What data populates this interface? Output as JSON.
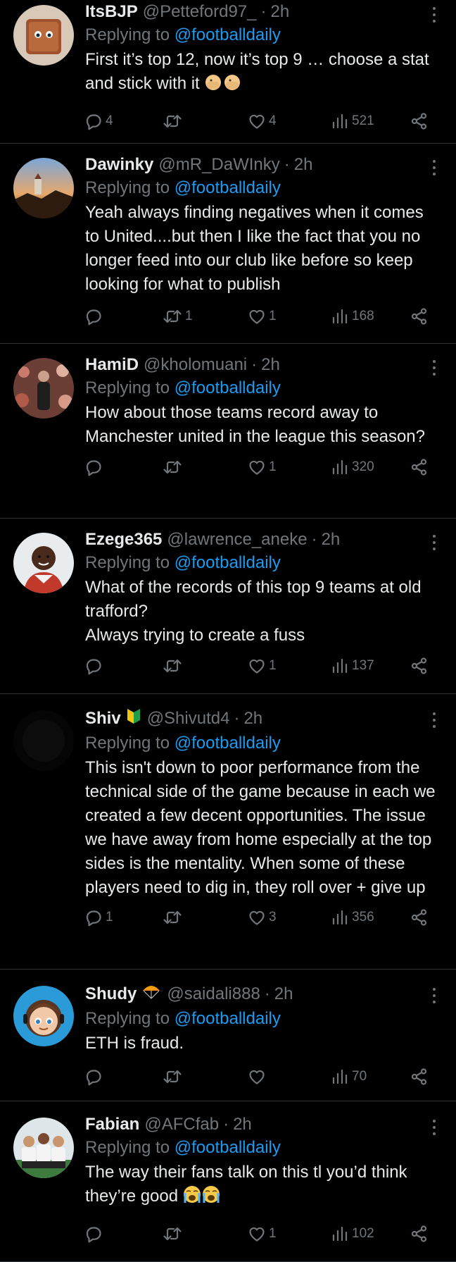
{
  "colors": {
    "background": "#000000",
    "text": "#e7e9ea",
    "muted": "#71767b",
    "link": "#1d9bf0",
    "divider": "#2f3336"
  },
  "icons": {
    "reply": "speech-bubble",
    "retweet": "retweet-arrows",
    "like": "heart",
    "views": "bar-chart",
    "share": "share-nodes",
    "more": "vertical-ellipsis"
  },
  "tweets": [
    {
      "name": "ItsBJP",
      "handle": "@Petteford97_",
      "time": "2h",
      "reply_prefix": "Replying to",
      "reply_to": "@footballdaily",
      "text": "First it’s top 12, now it’s top 9 … choose a stat and stick with it",
      "text_emoji": "facepalm-emoji",
      "replies": "4",
      "retweets": "",
      "likes": "4",
      "views": "521"
    },
    {
      "name": "Dawinky",
      "handle": "@mR_DaWInky",
      "time": "2h",
      "reply_prefix": "Replying to",
      "reply_to": "@footballdaily",
      "text": "Yeah always finding negatives when it comes to United....but then I like the fact that you no longer feed into our club like before so keep looking for what to publish",
      "replies": "",
      "retweets": "1",
      "likes": "1",
      "views": "168"
    },
    {
      "name": "HamiD",
      "handle": "@kholomuani",
      "time": "2h",
      "reply_prefix": "Replying to",
      "reply_to": "@footballdaily",
      "text": "How about those teams record away to Manchester united in the league this season?",
      "replies": "",
      "retweets": "",
      "likes": "1",
      "views": "320"
    },
    {
      "name": "Ezege365",
      "handle": "@lawrence_aneke",
      "time": "2h",
      "reply_prefix": "Replying to",
      "reply_to": "@footballdaily",
      "text": "What of the records of this top 9 teams at old trafford?\nAlways trying to create a fuss",
      "replies": "",
      "retweets": "",
      "likes": "1",
      "views": "137"
    },
    {
      "name": "Shiv",
      "name_emoji": "beginner-badge-emoji",
      "handle": "@Shivutd4",
      "time": "2h",
      "reply_prefix": "Replying to",
      "reply_to": "@footballdaily",
      "text": "This isn't down to poor performance from the technical side of the game because in each we created a few decent opportunities. The issue we have away from home especially at the top sides is the mentality. When some of these players need to dig in, they roll over + give up",
      "replies": "1",
      "retweets": "",
      "likes": "3",
      "views": "356"
    },
    {
      "name": "Shudy",
      "name_emoji": "parachute-emoji",
      "handle": "@saidali888",
      "time": "2h",
      "reply_prefix": "Replying to",
      "reply_to": "@footballdaily",
      "text": "ETH is fraud.",
      "replies": "",
      "retweets": "",
      "likes": "",
      "views": "70"
    },
    {
      "name": "Fabian",
      "handle": "@AFCfab",
      "time": "2h",
      "reply_prefix": "Replying to",
      "reply_to": "@footballdaily",
      "text": "The way their fans talk on this tl you’d think they’re good",
      "text_emoji": "crying-emoji",
      "replies": "",
      "retweets": "",
      "likes": "1",
      "views": "102"
    }
  ]
}
